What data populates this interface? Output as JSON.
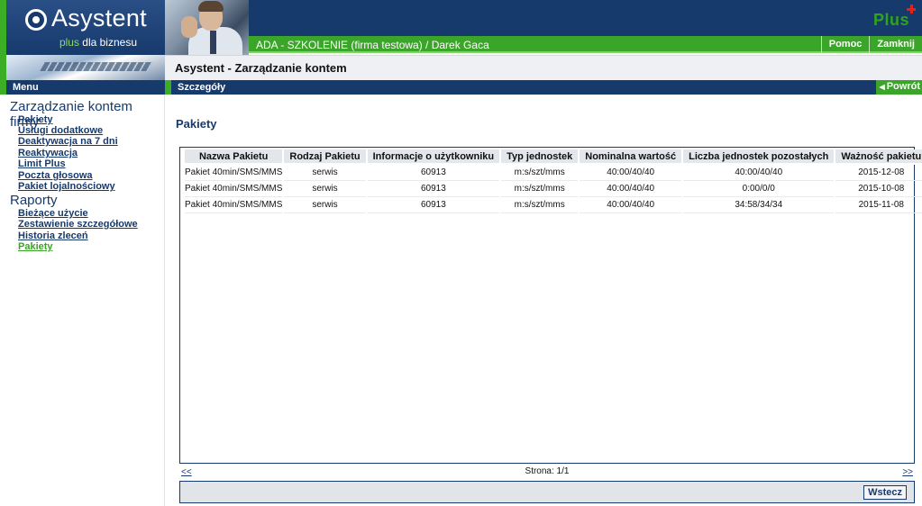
{
  "header": {
    "logo_text": "Asystent",
    "logo_sub_plus": "plus",
    "logo_sub_rest": " dla biznesu",
    "brand": "Plus",
    "user_info": "ADA - SZKOLENIE (firma testowa) / Darek Gaca",
    "nav": {
      "help": "Pomoc",
      "close": "Zamknij"
    }
  },
  "title_bar": {
    "title": "Asystent - Zarządzanie kontem"
  },
  "menu": {
    "label": "Menu"
  },
  "details": {
    "label": "Szczegóły",
    "back": "Powrót"
  },
  "sidebar": {
    "section1": "Zarządzanie kontem firmy",
    "items1": [
      "Pakiety",
      "Usługi dodatkowe",
      "Deaktywacja na 7 dni",
      "Reaktywacja",
      "Limit Plus",
      "Poczta głosowa",
      "Pakiet lojalnościowy"
    ],
    "section2": "Raporty",
    "items2": [
      "Bieżące użycie",
      "Zestawienie szczegółowe",
      "Historia zleceń",
      "Pakiety"
    ]
  },
  "content": {
    "title": "Pakiety",
    "columns": [
      "Nazwa Pakietu",
      "Rodzaj Pakietu",
      "Informacje o użytkowniku",
      "Typ jednostek",
      "Nominalna wartość",
      "Liczba jednostek pozostałych",
      "Ważność pakietu"
    ],
    "rows": [
      [
        "Pakiet 40min/SMS/MMS",
        "serwis",
        "60913",
        "m:s/szt/mms",
        "40:00/40/40",
        "40:00/40/40",
        "2015-12-08"
      ],
      [
        "Pakiet 40min/SMS/MMS",
        "serwis",
        "60913",
        "m:s/szt/mms",
        "40:00/40/40",
        "0:00/0/0",
        "2015-10-08"
      ],
      [
        "Pakiet 40min/SMS/MMS",
        "serwis",
        "60913",
        "m:s/szt/mms",
        "40:00/40/40",
        "34:58/34/34",
        "2015-11-08"
      ]
    ]
  },
  "pager": {
    "prev": "<<",
    "info": "Strona: 1/1",
    "next": ">>"
  },
  "footer": {
    "back_button": "Wstecz"
  }
}
